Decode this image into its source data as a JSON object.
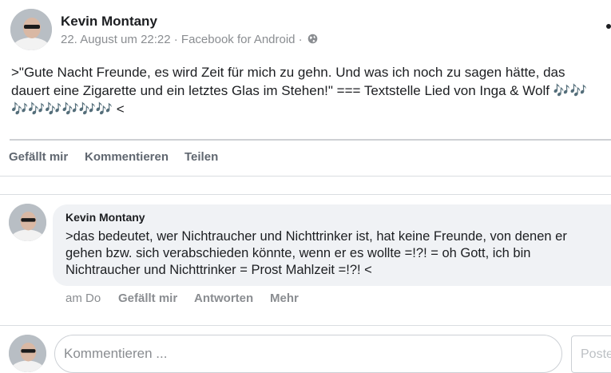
{
  "post": {
    "author": "Kevin Montany",
    "meta": "22. August um 22:22 · Facebook for Android ·",
    "body_lines": [
      ">\"Gute Nacht Freunde, es wird Zeit für mich zu gehn. Und was ich noch zu sagen hätte, das",
      "dauert eine Zigarette und ein letztes Glas im Stehen!\" === Textstelle Lied von Inga & Wolf 🎶🎶",
      "🎶🎶🎶🎶🎶🎶 <"
    ],
    "actions": {
      "like": "Gefällt mir",
      "comment": "Kommentieren",
      "share": "Teilen"
    },
    "icons": {
      "privacy": "globe-icon",
      "menu": "more-icon"
    }
  },
  "comment": {
    "author": "Kevin Montany",
    "text_lines": [
      ">das bedeutet, wer Nichtraucher und Nichttrinker ist, hat keine Freunde, von denen er",
      "gehen bzw. sich verabschieden könnte, wenn er es wollte =!?! = oh Gott, ich bin",
      "Nichtraucher und Nichttrinker = Prost Mahlzeit =!?! <"
    ],
    "time": "am Do",
    "like": "Gefällt mir",
    "reply": "Antworten",
    "more": "Mehr"
  },
  "composer": {
    "placeholder": "Kommentieren ...",
    "post_button": "Poste"
  },
  "colors": {
    "text": "#1c1e21",
    "secondary": "#8a8d91",
    "action": "#606770",
    "bubble": "#f0f2f5"
  }
}
